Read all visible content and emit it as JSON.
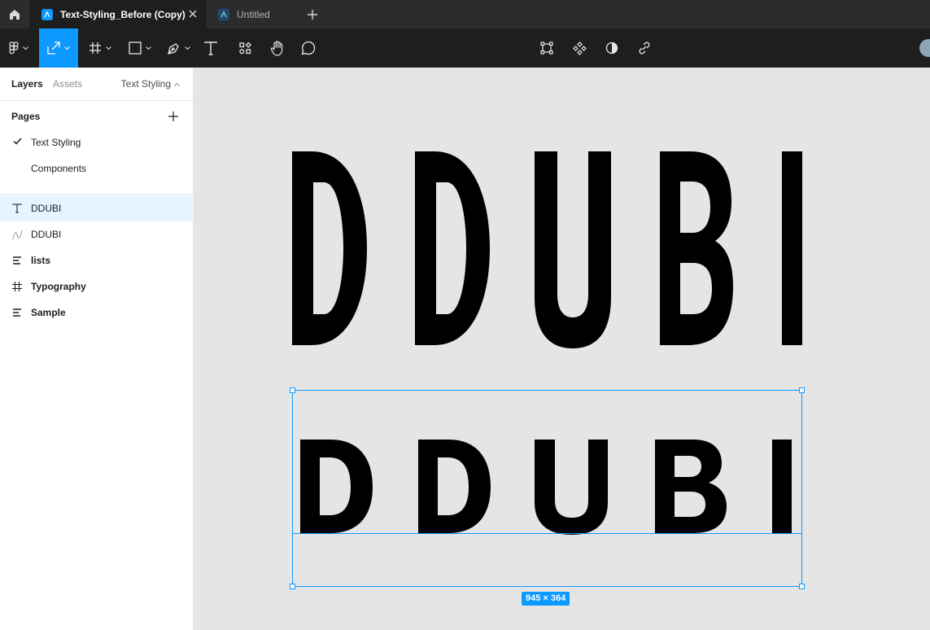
{
  "tabs": [
    {
      "label": "Text-Styling_Before (Copy)",
      "active": true
    },
    {
      "label": "Untitled",
      "active": false
    }
  ],
  "toolbar": {
    "tools": [
      "main-menu",
      "move",
      "frame",
      "shape",
      "pen",
      "text",
      "resources",
      "hand",
      "comment"
    ],
    "selected_tool": "move",
    "center_tools": [
      "transform",
      "component",
      "mask",
      "link"
    ],
    "accent": "#0d99ff"
  },
  "panel": {
    "tab_layers": "Layers",
    "tab_assets": "Assets",
    "current_page": "Text Styling",
    "pages_title": "Pages",
    "pages": [
      {
        "label": "Text Styling",
        "current": true
      },
      {
        "label": "Components",
        "current": false
      }
    ],
    "layers": [
      {
        "name": "DDUBI",
        "icon": "text-icon",
        "selected": true,
        "bold": false
      },
      {
        "name": "DDUBI",
        "icon": "vector-icon",
        "selected": false,
        "bold": false
      },
      {
        "name": "lists",
        "icon": "auto-layout-icon",
        "selected": false,
        "bold": true
      },
      {
        "name": "Typography",
        "icon": "frame-icon",
        "selected": false,
        "bold": true
      },
      {
        "name": "Sample",
        "icon": "auto-layout-icon",
        "selected": false,
        "bold": true
      }
    ]
  },
  "canvas": {
    "top_text": "DDUBI",
    "bottom_text": "DDUBI",
    "selection_size": "945 × 364"
  }
}
